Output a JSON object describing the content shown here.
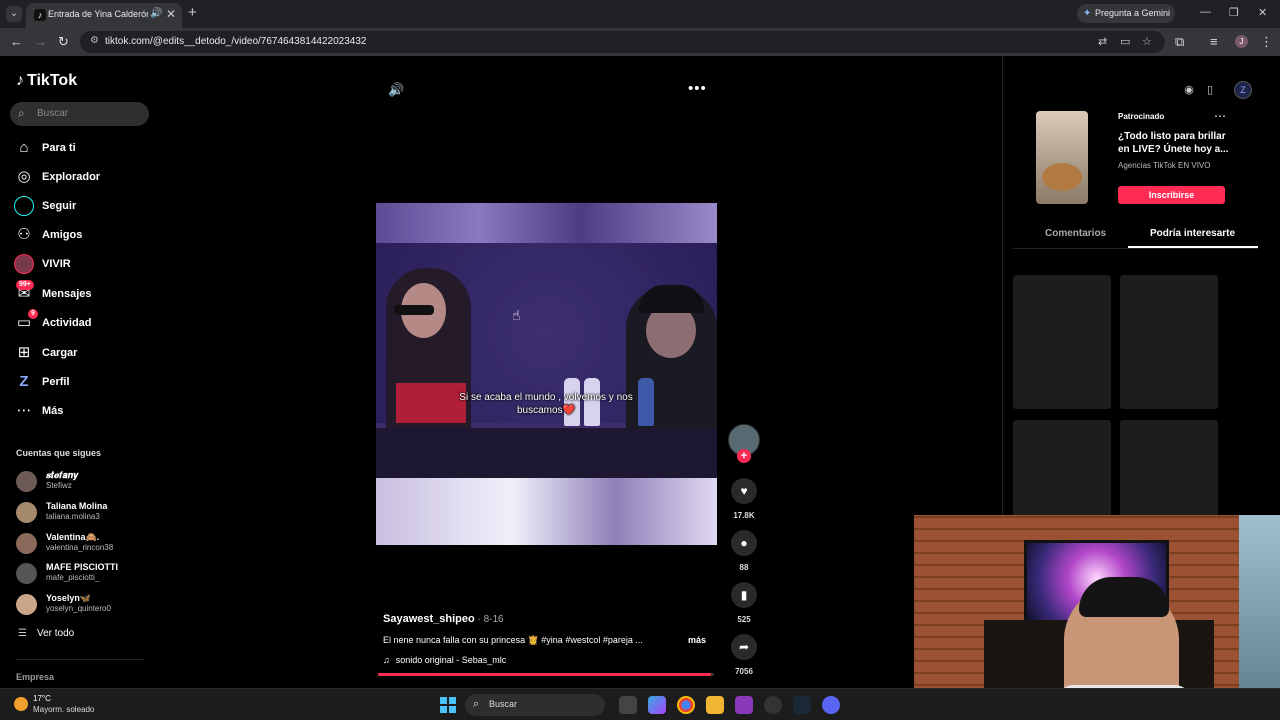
{
  "browser": {
    "tab_title": "Entrada de Yina Calderón c",
    "gemini_label": "Pregunta a Gemini",
    "url": "tiktok.com/@edits__detodo_/video/7674643814422023432"
  },
  "sidebar": {
    "logo": "TikTok",
    "search_placeholder": "Buscar",
    "nav": [
      {
        "label": "Para ti",
        "icon": "home-icon"
      },
      {
        "label": "Explorador",
        "icon": "compass-icon"
      },
      {
        "label": "Seguir",
        "icon": "following-icon"
      },
      {
        "label": "Amigos",
        "icon": "friends-icon"
      },
      {
        "label": "VIVIR",
        "icon": "live-icon"
      },
      {
        "label": "Mensajes",
        "icon": "messages-icon",
        "badge": "99+"
      },
      {
        "label": "Actividad",
        "icon": "activity-icon",
        "badge": "9"
      },
      {
        "label": "Cargar",
        "icon": "upload-icon"
      },
      {
        "label": "Perfil",
        "icon": "profile-icon"
      },
      {
        "label": "Más",
        "icon": "more-icon"
      }
    ],
    "following_title": "Cuentas que sigues",
    "following": [
      {
        "name": "𝒔𝒕𝒆𝒇𝒂𝒏𝒚",
        "handle": "Stefiwz"
      },
      {
        "name": "Taliana Molina",
        "handle": "taliana.molina3"
      },
      {
        "name": "Valentina🙈.",
        "handle": "valentina_rincon38"
      },
      {
        "name": "MAFE PISCIOTTI",
        "handle": "mafe_pisciotti_"
      },
      {
        "name": "Yoselyn🦋",
        "handle": "yoselyn_quintero0"
      }
    ],
    "see_all": "Ver todo",
    "footer": "Empresa"
  },
  "video": {
    "subtitle": "Si se acaba el mundo , volvemos y nos buscamos❤️",
    "progress": 0.99
  },
  "actions": {
    "likes": "17.8K",
    "comments": "88",
    "saves": "525",
    "shares": "7056"
  },
  "post": {
    "author": "Sayawest_shipeo",
    "date": " · 8-16",
    "caption": "El nene nunca falla con su princesa 👸 #yina #westcol #pareja ...",
    "more": "más",
    "music": "sonido original - Sebas_mlc"
  },
  "ad": {
    "sponsored": "Patrocinado",
    "title": "¿Todo listo para brillar en LIVE? Únete hoy a...",
    "subtitle": "Agencias TikTok EN VIVO",
    "cta": "Inscribirse"
  },
  "right_tabs": {
    "comments": "Comentarios",
    "suggested": "Podría interesarte"
  },
  "taskbar": {
    "temperature": "17°C",
    "weather": "Mayorm. soleado",
    "search_placeholder": "Buscar"
  },
  "colors": {
    "accent": "#fe2c55",
    "background": "#000000"
  }
}
